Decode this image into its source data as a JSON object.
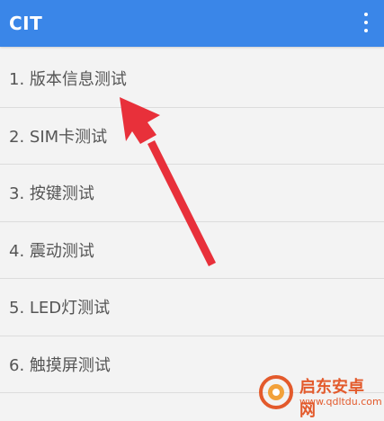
{
  "appbar": {
    "title": "CIT",
    "menu_icon": "more-vert-icon",
    "color": "#3a86e8"
  },
  "list": {
    "items": [
      {
        "label": "1. 版本信息测试"
      },
      {
        "label": "2. SIM卡测试"
      },
      {
        "label": "3. 按键测试"
      },
      {
        "label": "4. 震动测试"
      },
      {
        "label": "5. LED灯测试"
      },
      {
        "label": "6. 触摸屏测试"
      }
    ]
  },
  "annotation": {
    "arrow_color": "#e8303a",
    "arrow_icon": "pointer-arrow"
  },
  "watermark": {
    "brand": "启东安卓网",
    "url": "www.qdltdu.com",
    "logo_icon": "watermark-logo-icon",
    "color": "#e35a2c"
  }
}
